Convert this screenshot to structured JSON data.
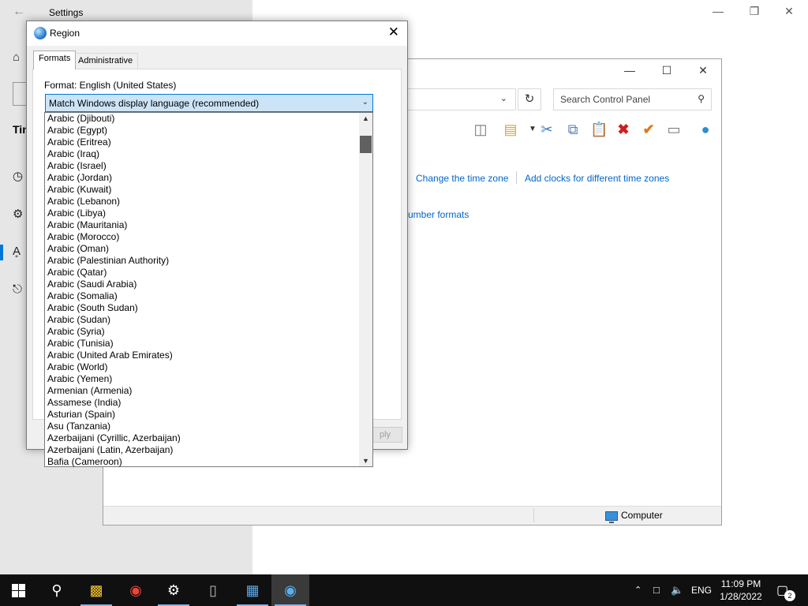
{
  "settings": {
    "title": "Settings",
    "side_fragment": "Tin",
    "side_icons": [
      "home-icon",
      "search-box-fragment",
      "clock-calendar-icon",
      "globe-gear-icon",
      "language-icon",
      "microphone-icon"
    ]
  },
  "control_panel": {
    "search_placeholder": "Search Control Panel",
    "links": {
      "change_time_zone": "Change the time zone",
      "add_clocks": "Add clocks for different time zones",
      "number_formats": "umber formats"
    },
    "status_bar": {
      "computer": "Computer"
    },
    "toolbar_icons": [
      "pane-icon",
      "properties-icon",
      "dropdown-icon",
      "cut-icon",
      "copy-icon",
      "paste-icon",
      "delete-icon",
      "checkmark-icon",
      "rename-icon",
      "globe-icon"
    ]
  },
  "region_dialog": {
    "title": "Region",
    "tabs": [
      {
        "label": "Formats",
        "active": true
      },
      {
        "label": "Administrative",
        "active": false
      }
    ],
    "format_label": "Format: English (United States)",
    "format_select": "Match Windows display language (recommended)",
    "apply_fragment": "ply",
    "dropdown_items": [
      "Arabic (Djibouti)",
      "Arabic (Egypt)",
      "Arabic (Eritrea)",
      "Arabic (Iraq)",
      "Arabic (Israel)",
      "Arabic (Jordan)",
      "Arabic (Kuwait)",
      "Arabic (Lebanon)",
      "Arabic (Libya)",
      "Arabic (Mauritania)",
      "Arabic (Morocco)",
      "Arabic (Oman)",
      "Arabic (Palestinian Authority)",
      "Arabic (Qatar)",
      "Arabic (Saudi Arabia)",
      "Arabic (Somalia)",
      "Arabic (South Sudan)",
      "Arabic (Sudan)",
      "Arabic (Syria)",
      "Arabic (Tunisia)",
      "Arabic (United Arab Emirates)",
      "Arabic (World)",
      "Arabic (Yemen)",
      "Armenian (Armenia)",
      "Assamese (India)",
      "Asturian (Spain)",
      "Asu (Tanzania)",
      "Azerbaijani (Cyrillic, Azerbaijan)",
      "Azerbaijani (Latin, Azerbaijan)",
      "Bafia (Cameroon)"
    ]
  },
  "taskbar": {
    "apps": [
      "start-icon",
      "search-icon",
      "file-explorer-icon",
      "chrome-icon",
      "settings-gear-icon",
      "mouse-icon",
      "control-panel-icon",
      "region-globe-icon"
    ],
    "language": "ENG",
    "time": "11:09 PM",
    "date": "1/28/2022",
    "notification_count": "2"
  },
  "colors": {
    "accent": "#0078d7",
    "link": "#0066cc",
    "taskbar": "#101010",
    "select_highlight": "#cce4f7"
  }
}
